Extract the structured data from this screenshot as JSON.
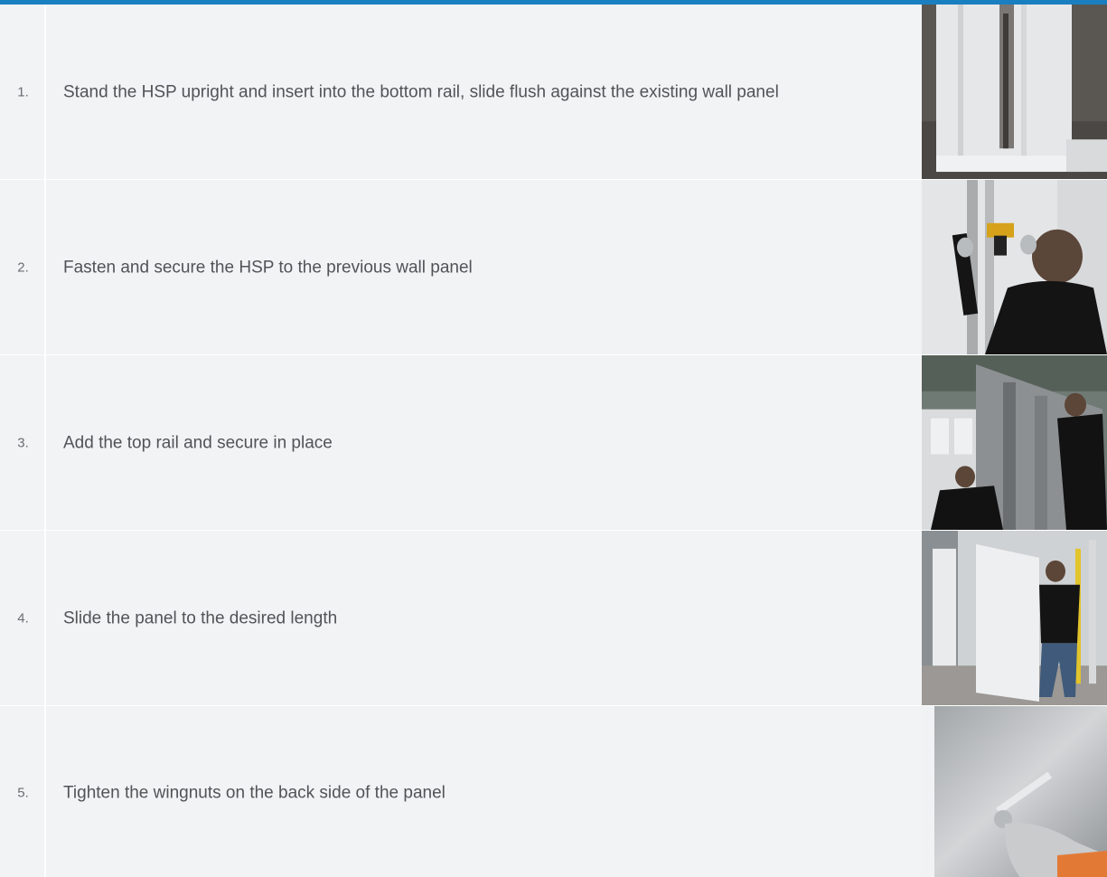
{
  "steps": [
    {
      "number": "1.",
      "text": "Stand the HSP upright and insert into the bottom rail, slide flush against the existing wall panel",
      "photo_icon": "panel-bottom-rail-photo"
    },
    {
      "number": "2.",
      "text": "Fasten and secure the HSP to the previous wall panel",
      "photo_icon": "worker-drilling-photo"
    },
    {
      "number": "3.",
      "text": "Add the top rail and secure in place",
      "photo_icon": "workers-top-rail-photo"
    },
    {
      "number": "4.",
      "text": "Slide the panel to the desired length",
      "photo_icon": "worker-sliding-panel-photo"
    },
    {
      "number": "5.",
      "text": "Tighten the wingnuts on the back side of the panel",
      "photo_icon": "wingnut-tighten-photo"
    }
  ],
  "colors": {
    "accent": "#1a7fc1",
    "row_bg": "#f2f3f4",
    "text": "#505457"
  }
}
